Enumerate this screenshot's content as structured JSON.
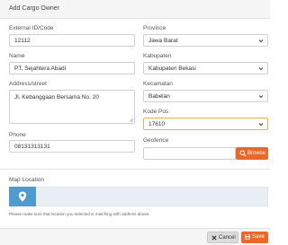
{
  "modal": {
    "title": "Add Cargo Owner"
  },
  "form": {
    "external_id": {
      "label": "External ID/Code",
      "value": "12112"
    },
    "name": {
      "label": "Name",
      "value": "PT. Sejahtera Abadi"
    },
    "address": {
      "label": "Address/street",
      "value": "Jl. Kebanggaan Bersama No. 20"
    },
    "phone": {
      "label": "Phone",
      "value": "08131313131"
    },
    "province": {
      "label": "Province",
      "value": "Jawa Barat"
    },
    "kabupaten": {
      "label": "Kabupaten",
      "value": "Kabupaten Bekasi"
    },
    "kecamatan": {
      "label": "Kecamatan",
      "value": "Babelan"
    },
    "kode_pos": {
      "label": "Kode Pos",
      "value": "17610"
    },
    "geofence": {
      "label": "Geofence",
      "value": "",
      "browse_label": "Browse"
    }
  },
  "map": {
    "label": "Map Location",
    "note": "Please make sure that location you selected is matching with address above."
  },
  "footer": {
    "cancel_label": "Cancel",
    "save_label": "Save"
  },
  "colors": {
    "accent": "#e8692b",
    "map_marker": "#4f9bd0",
    "focus_border": "#f0ad4e"
  }
}
